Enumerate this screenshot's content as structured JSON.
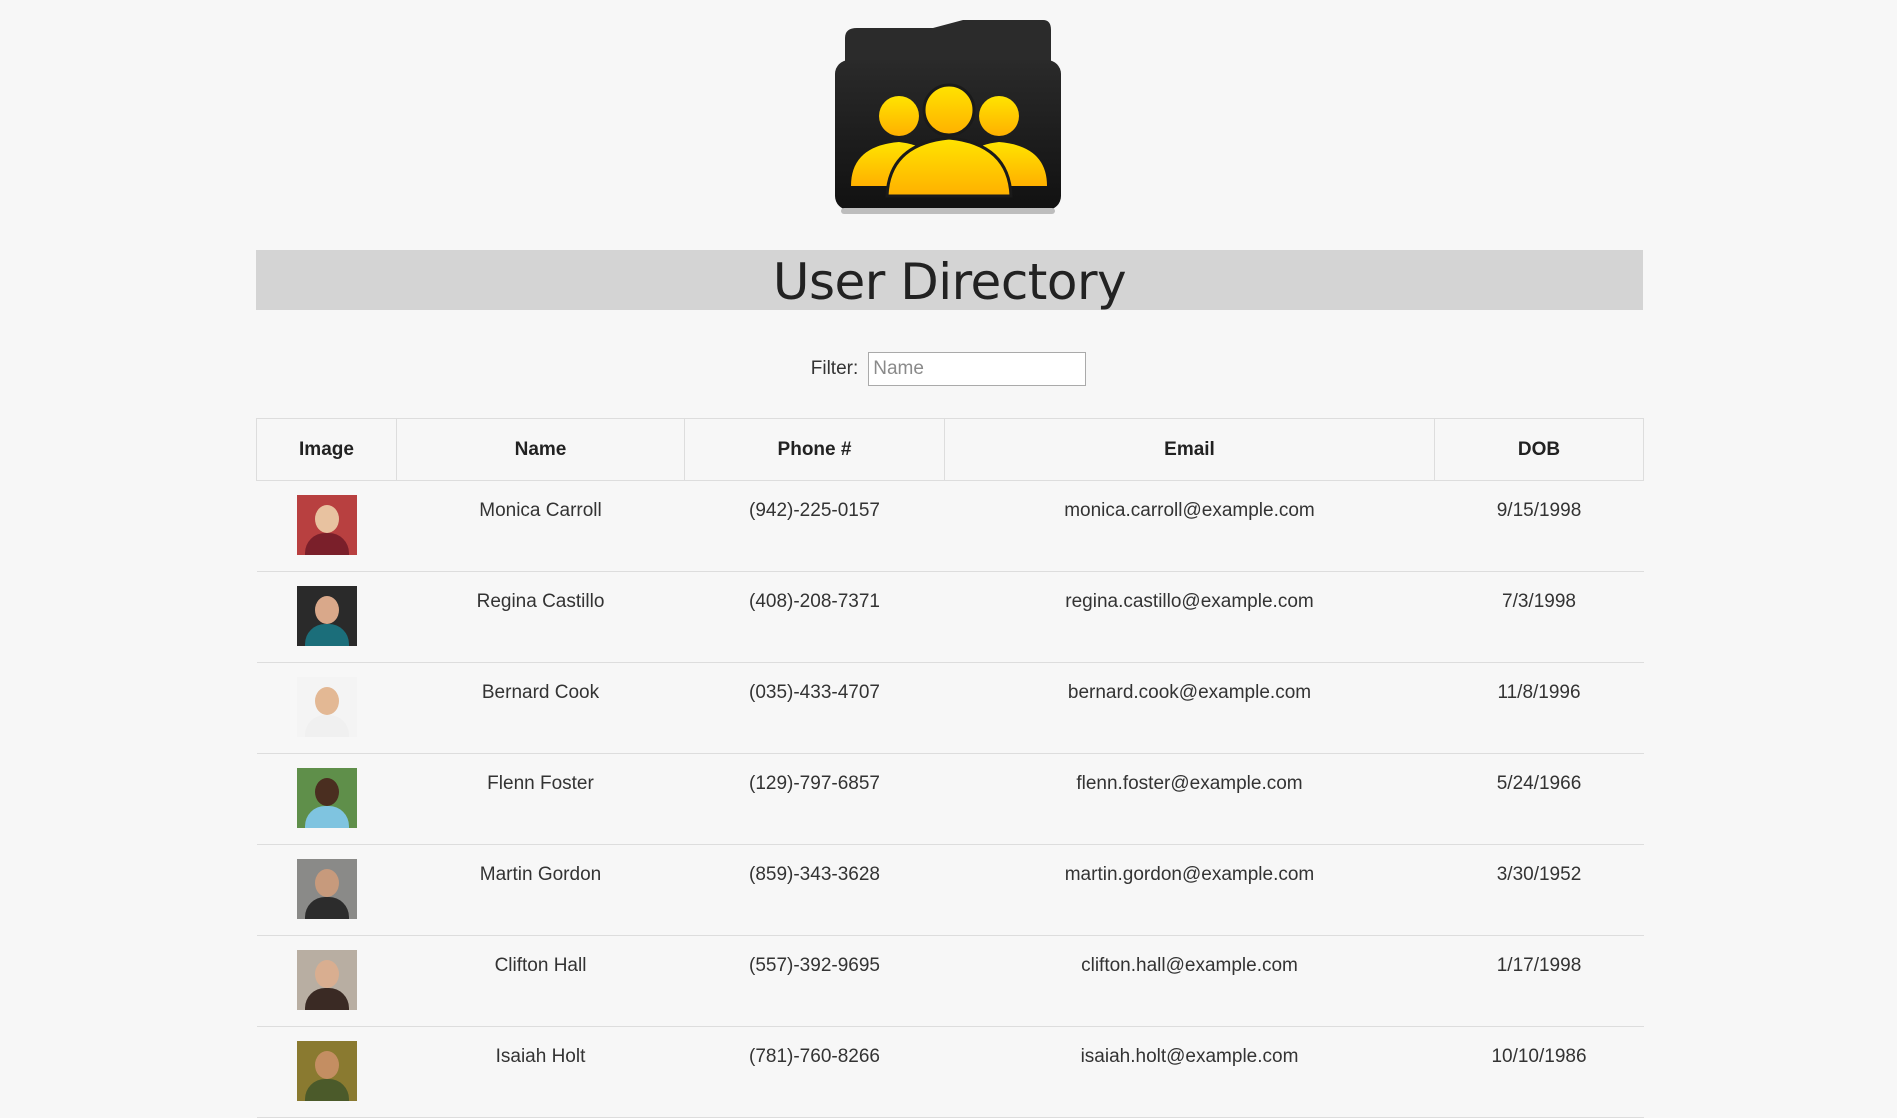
{
  "header": {
    "logo_icon": "users-folder-icon",
    "title": "User Directory"
  },
  "filter": {
    "label": "Filter:",
    "placeholder": "Name",
    "value": ""
  },
  "table": {
    "columns": [
      "Image",
      "Name",
      "Phone #",
      "Email",
      "DOB"
    ],
    "rows": [
      {
        "name": "Monica Carroll",
        "phone": "(942)-225-0157",
        "email": "monica.carroll@example.com",
        "dob": "9/15/1998",
        "avatar_bg": "#b84040",
        "avatar_skin": "#e8c2a0",
        "avatar_shirt": "#7a1f2a"
      },
      {
        "name": "Regina Castillo",
        "phone": "(408)-208-7371",
        "email": "regina.castillo@example.com",
        "dob": "7/3/1998",
        "avatar_bg": "#2a2a2a",
        "avatar_skin": "#d9a88a",
        "avatar_shirt": "#1b6e7a"
      },
      {
        "name": "Bernard Cook",
        "phone": "(035)-433-4707",
        "email": "bernard.cook@example.com",
        "dob": "11/8/1996",
        "avatar_bg": "#f4f4f4",
        "avatar_skin": "#e3b894",
        "avatar_shirt": "#f0f0f0"
      },
      {
        "name": "Flenn Foster",
        "phone": "(129)-797-6857",
        "email": "flenn.foster@example.com",
        "dob": "5/24/1966",
        "avatar_bg": "#5f8f4a",
        "avatar_skin": "#4a2e20",
        "avatar_shirt": "#7fc4e0"
      },
      {
        "name": "Martin Gordon",
        "phone": "(859)-343-3628",
        "email": "martin.gordon@example.com",
        "dob": "3/30/1952",
        "avatar_bg": "#8a8a88",
        "avatar_skin": "#c79a7c",
        "avatar_shirt": "#2c2c2c"
      },
      {
        "name": "Clifton Hall",
        "phone": "(557)-392-9695",
        "email": "clifton.hall@example.com",
        "dob": "1/17/1998",
        "avatar_bg": "#b8aea2",
        "avatar_skin": "#d9ae90",
        "avatar_shirt": "#3a2a24"
      },
      {
        "name": "Isaiah Holt",
        "phone": "(781)-760-8266",
        "email": "isaiah.holt@example.com",
        "dob": "10/10/1986",
        "avatar_bg": "#8a7a30",
        "avatar_skin": "#c48e62",
        "avatar_shirt": "#4b5a2a"
      }
    ]
  }
}
